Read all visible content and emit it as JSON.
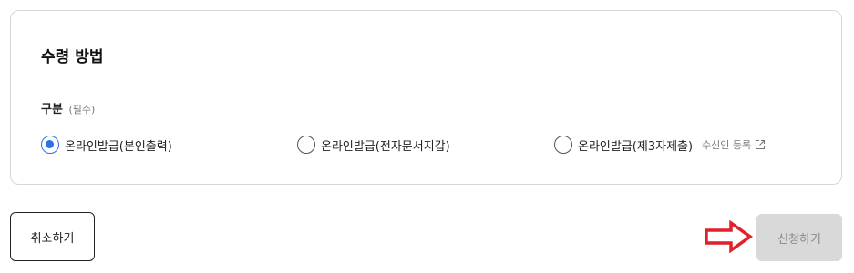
{
  "section": {
    "title": "수령 방법"
  },
  "field": {
    "label": "구분",
    "required": "(필수)"
  },
  "options": [
    {
      "label": "온라인발급(본인출력)",
      "checked": true
    },
    {
      "label": "온라인발급(전자문서지갑)",
      "checked": false
    },
    {
      "label": "온라인발급(제3자제출)",
      "checked": false,
      "link": "수신인 등록"
    }
  ],
  "buttons": {
    "cancel": "취소하기",
    "apply": "신청하기"
  },
  "colors": {
    "accent": "#2f6fe8",
    "annotation_arrow": "#e1212a",
    "disabled_button": "#d9d9d9"
  },
  "icons": {
    "external_link": "external-link-icon",
    "annotation": "right-arrow-annotation"
  }
}
